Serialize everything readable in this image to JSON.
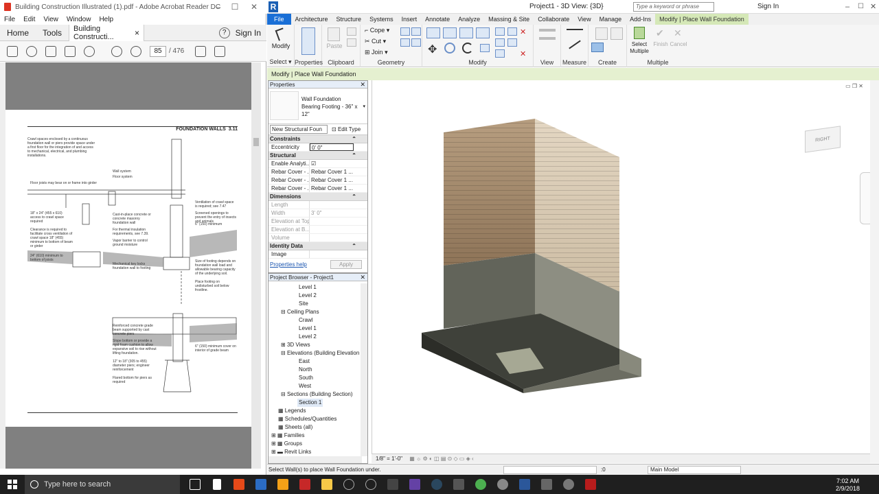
{
  "acrobat": {
    "title": "Building Construction Illustrated (1).pdf - Adobe Acrobat Reader DC",
    "menu": [
      "File",
      "Edit",
      "View",
      "Window",
      "Help"
    ],
    "tabs": {
      "home": "Home",
      "tools": "Tools",
      "doc": "Building Constructi...",
      "close": "×",
      "help": "?",
      "signin": "Sign In"
    },
    "page_current": "85",
    "page_total": "/ 476",
    "page_header": "FOUNDATION WALLS",
    "page_number": "3.11",
    "notes": [
      "Crawl spaces enclosed by a continuous foundation wall or piers provide space under a first floor for the integration of and access to mechanical, electrical, and plumbing installations.",
      "Wall system",
      "Floor system",
      "Floor joists may bear on or frame into girder",
      "18\" x 24\" (455 x 610) access to crawl space required",
      "Clearance is required to facilitate cross ventilation of crawl space 18\" (455) minimum to bottom of beam or girder",
      "24\" (610) minimum to bottom of joists",
      "Cast-in-place concrete or concrete masonry foundation wall",
      "For thermal insulation requirements, see 7.39.",
      "Vapor barrier to control ground moisture",
      "Mechanical key locks foundation wall to footing",
      "Ventilation of crawl space is required; see 7.47",
      "Screened openings to prevent the entry of insects and animals",
      "6\" (150) minimum",
      "Size of footing depends on foundation wall load and allowable bearing capacity of the underlying soil.",
      "Place footing on undisturbed soil below frostline.",
      "Reinforced concrete grade beam supported by cast concrete piers",
      "Slope bottom or provide a rigid foam cushion to allow expansive soil to rise without lifting foundation.",
      "12\" to 18\" (305 to 455) diameter piers; engineer reinforcement",
      "Flared bottom for piers as required",
      "6\" (150) minimum cover on interior of grade beam"
    ]
  },
  "revit": {
    "title": "Project1 - 3D View: {3D}",
    "search_placeholder": "Type a keyword or phrase",
    "sign_in": "Sign In",
    "tabs": [
      "File",
      "Architecture",
      "Structure",
      "Systems",
      "Insert",
      "Annotate",
      "Analyze",
      "Massing & Site",
      "Collaborate",
      "View",
      "Manage",
      "Add-Ins",
      "Modify | Place Wall Foundation"
    ],
    "ribbon": {
      "select_label": "Select",
      "modify": "Modify",
      "properties": "Properties",
      "paste": "Paste",
      "clipboard": "Clipboard",
      "cope": "Cope",
      "cut": "Cut",
      "join": "Join",
      "geometry": "Geometry",
      "modify_panel": "Modify",
      "view": "View",
      "measure": "Measure",
      "create": "Create",
      "select_multiple": "Select Multiple",
      "finish": "Finish",
      "cancel": "Cancel",
      "multiple": "Multiple"
    },
    "context_bar": "Modify | Place Wall Foundation",
    "properties": {
      "header": "Properties",
      "family": "Wall Foundation",
      "type": "Bearing Footing - 36\" x 12\"",
      "instance_dropdown": "New Structural Foun",
      "edit_type": "Edit Type",
      "groups": [
        {
          "name": "Constraints",
          "rows": [
            {
              "k": "Eccentricity",
              "v": "0' 0\"",
              "dim": false
            }
          ]
        },
        {
          "name": "Structural",
          "rows": [
            {
              "k": "Enable Analyti...",
              "v": "☑",
              "dim": false
            },
            {
              "k": "Rebar Cover - ...",
              "v": "Rebar Cover 1 ...",
              "dim": false
            },
            {
              "k": "Rebar Cover - ...",
              "v": "Rebar Cover 1 ...",
              "dim": false
            },
            {
              "k": "Rebar Cover - ...",
              "v": "Rebar Cover 1 ...",
              "dim": false
            }
          ]
        },
        {
          "name": "Dimensions",
          "rows": [
            {
              "k": "Length",
              "v": "",
              "dim": true
            },
            {
              "k": "Width",
              "v": "3' 0\"",
              "dim": true
            },
            {
              "k": "Elevation at Top",
              "v": "",
              "dim": true
            },
            {
              "k": "Elevation at B...",
              "v": "",
              "dim": true
            },
            {
              "k": "Volume",
              "v": "",
              "dim": true
            }
          ]
        },
        {
          "name": "Identity Data",
          "rows": [
            {
              "k": "Image",
              "v": "",
              "dim": false
            }
          ]
        }
      ],
      "help": "Properties help",
      "apply": "Apply"
    },
    "browser": {
      "header": "Project Browser - Project1",
      "items": [
        "Level 1",
        "Level 2",
        "Site",
        "Ceiling Plans",
        "Crawl",
        "Level 1",
        "Level 2",
        "3D Views",
        "Elevations (Building Elevation",
        "East",
        "North",
        "South",
        "West",
        "Sections (Building Section)",
        "Section 1",
        "Legends",
        "Schedules/Quantities",
        "Sheets (all)",
        "Families",
        "Groups",
        "Revit Links"
      ]
    },
    "viewcube": "RIGHT",
    "scale": "1/8\" = 1'-0\"",
    "status": "Select Wall(s) to place Wall Foundation under.",
    "status_zero": ":0",
    "model": "Main Model"
  },
  "taskbar": {
    "search": "Type here to search",
    "time": "7:02 AM",
    "date": "2/9/2018"
  }
}
